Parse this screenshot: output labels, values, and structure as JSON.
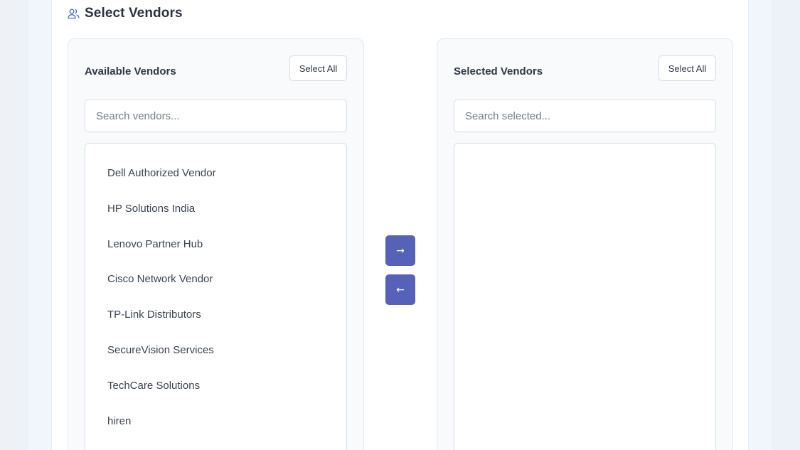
{
  "header": {
    "title": "Select Vendors",
    "icon": "users-icon"
  },
  "available": {
    "title": "Available Vendors",
    "select_all_label": "Select All",
    "search_placeholder": "Search vendors...",
    "items": [
      {
        "label": "Dell Authorized Vendor"
      },
      {
        "label": "HP Solutions India"
      },
      {
        "label": "Lenovo Partner Hub"
      },
      {
        "label": "Cisco Network Vendor"
      },
      {
        "label": "TP-Link Distributors"
      },
      {
        "label": "SecureVision Services"
      },
      {
        "label": "TechCare Solutions"
      },
      {
        "label": "hiren"
      }
    ]
  },
  "transfer": {
    "move_right_label": "→",
    "move_left_label": "←"
  },
  "selected": {
    "title": "Selected Vendors",
    "select_all_label": "Select All",
    "search_placeholder": "Search selected...",
    "items": []
  },
  "colors": {
    "accent": "#5562b8",
    "icon": "#4a6fd0"
  }
}
